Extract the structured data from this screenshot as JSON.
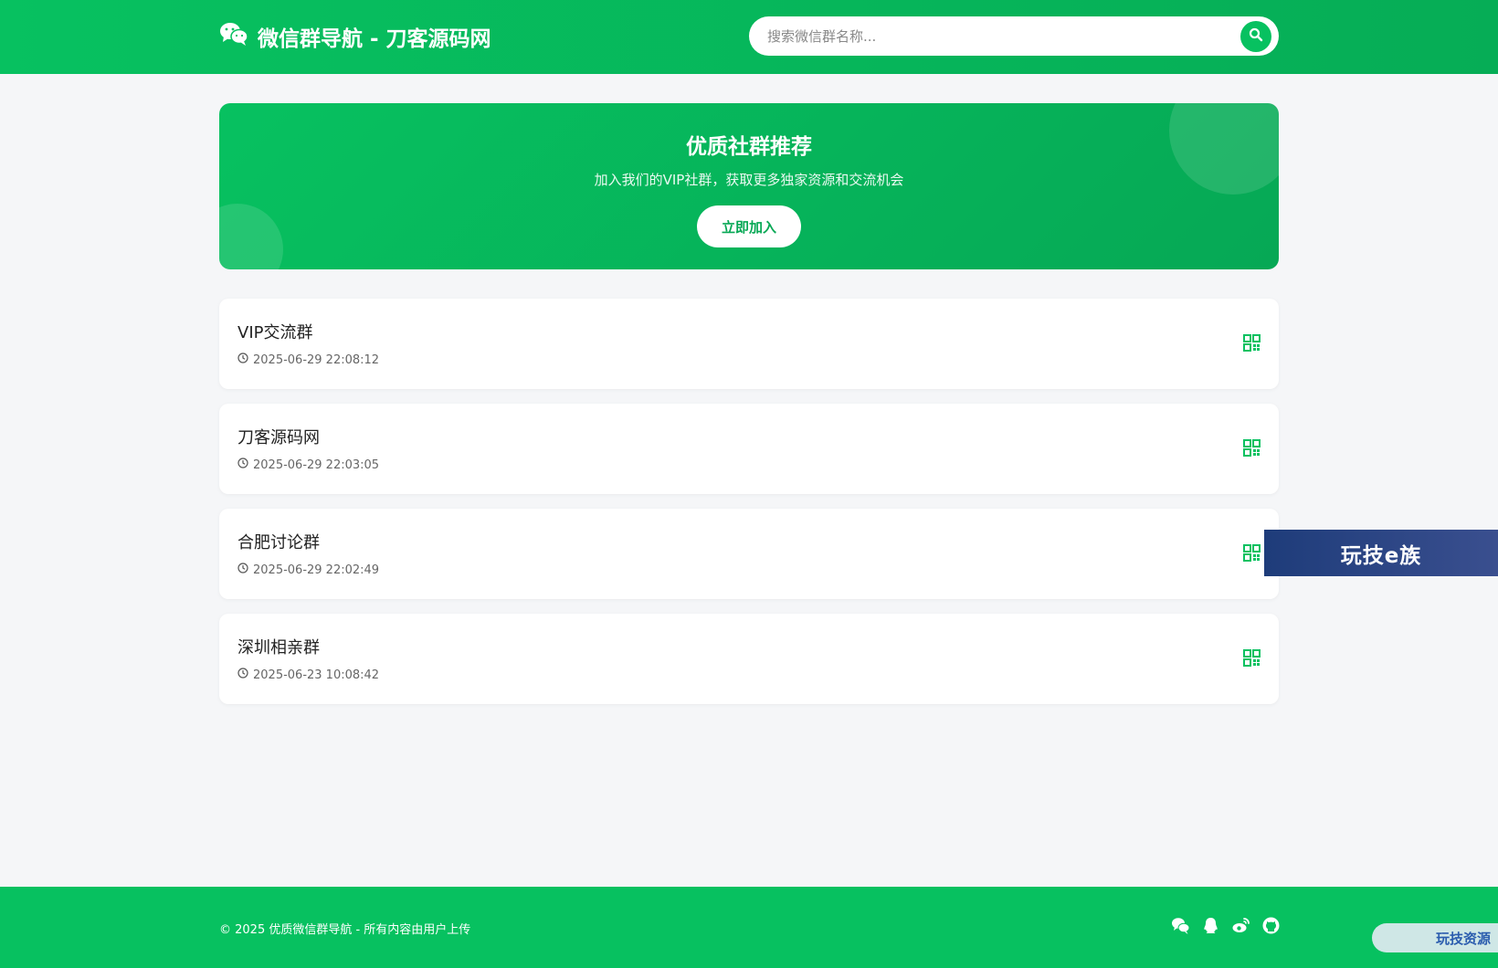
{
  "header": {
    "title": "微信群导航 - 刀客源码网",
    "search_placeholder": "搜索微信群名称..."
  },
  "banner": {
    "title": "优质社群推荐",
    "subtitle": "加入我们的VIP社群，获取更多独家资源和交流机会",
    "button_label": "立即加入"
  },
  "groups": [
    {
      "name": "VIP交流群",
      "time": "2025-06-29 22:08:12"
    },
    {
      "name": "刀客源码网",
      "time": "2025-06-29 22:03:05"
    },
    {
      "name": "合肥讨论群",
      "time": "2025-06-29 22:02:49"
    },
    {
      "name": "深圳相亲群",
      "time": "2025-06-23 10:08:42"
    }
  ],
  "float_ad": {
    "text": "玩技e族"
  },
  "footer": {
    "copyright": "© 2025 优质微信群导航 - 所有内容由用户上传",
    "icons": [
      "wechat-icon",
      "qq-icon",
      "weibo-icon",
      "github-icon"
    ],
    "corner_badge": "玩技资源"
  },
  "colors": {
    "accent": "#07c160",
    "accent_dark": "#06ad56"
  }
}
